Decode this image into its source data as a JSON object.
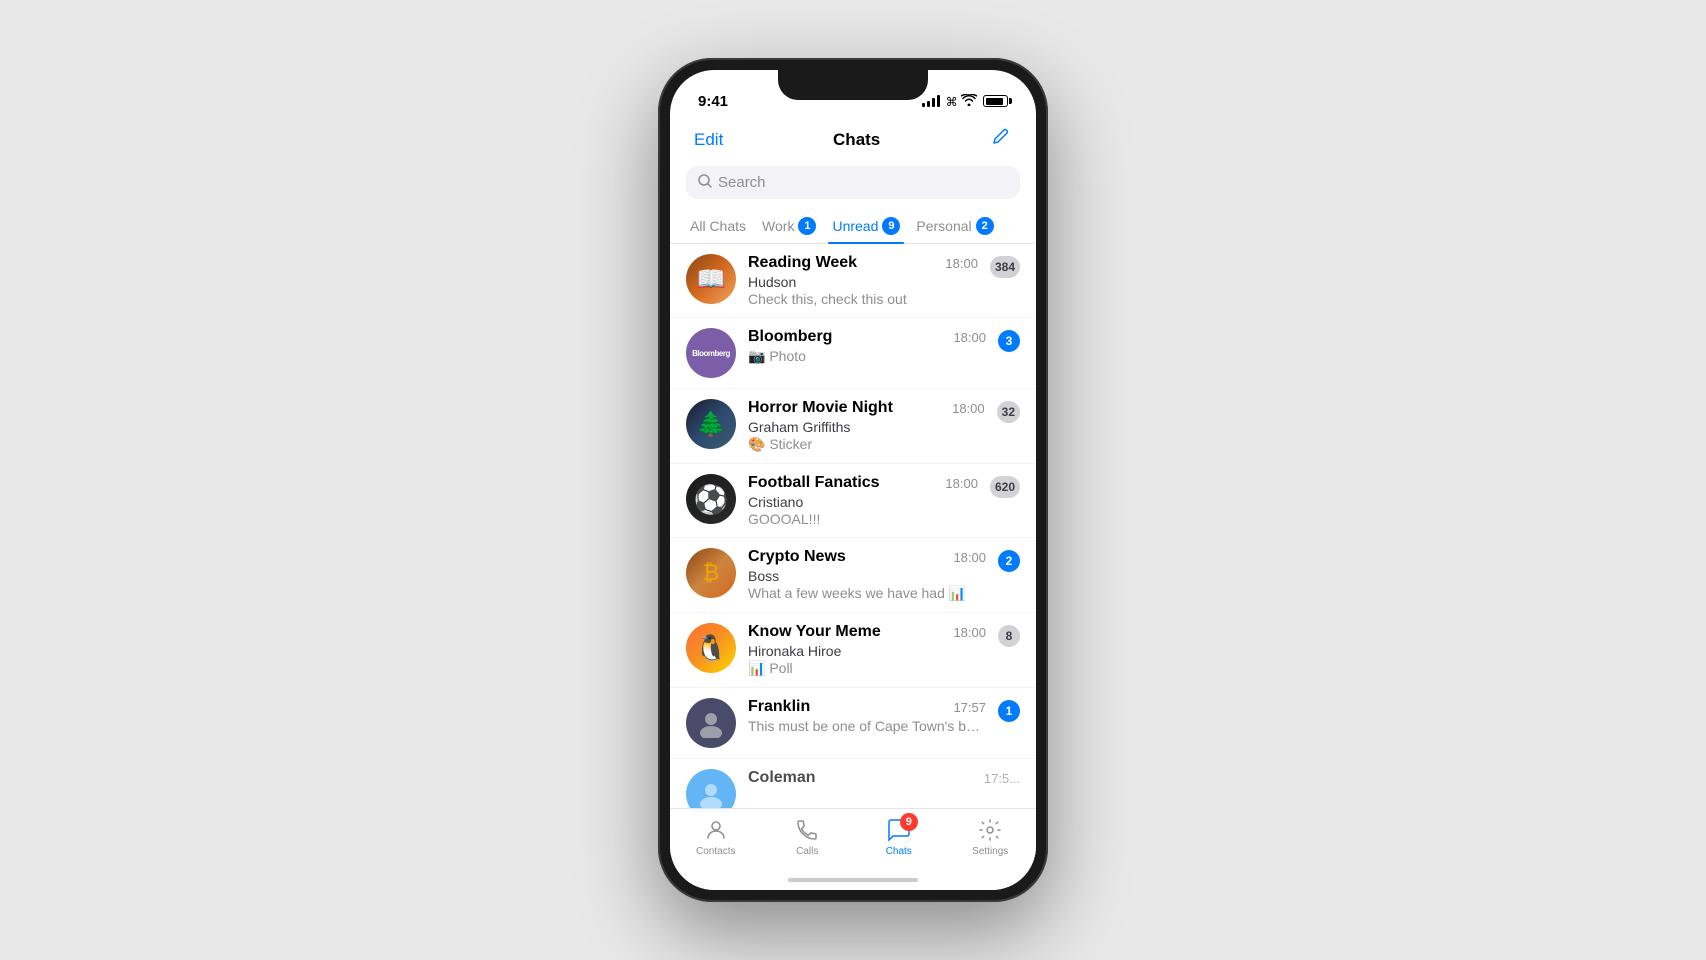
{
  "phone": {
    "status_bar": {
      "time": "9:41",
      "battery_level": 85
    },
    "header": {
      "edit_label": "Edit",
      "title": "Chats",
      "compose_icon": "✏"
    },
    "search": {
      "placeholder": "Search"
    },
    "tabs": [
      {
        "id": "all",
        "label": "All Chats",
        "badge": null,
        "badge_type": null,
        "active": false
      },
      {
        "id": "work",
        "label": "Work",
        "badge": "1",
        "badge_type": "blue",
        "active": false
      },
      {
        "id": "unread",
        "label": "Unread",
        "badge": "9",
        "badge_type": "blue",
        "active": true
      },
      {
        "id": "personal",
        "label": "Personal",
        "badge": "2",
        "badge_type": "blue",
        "active": false
      }
    ],
    "chats": [
      {
        "id": 1,
        "name": "Reading Week",
        "sender": "Hudson",
        "preview": "Check this, check this out",
        "time": "18:00",
        "unread": "384",
        "unread_type": "gray",
        "avatar_type": "reading-week",
        "avatar_emoji": "📚"
      },
      {
        "id": 2,
        "name": "Bloomberg",
        "sender": "",
        "preview": "📷 Photo",
        "time": "18:00",
        "unread": "3",
        "unread_type": "blue",
        "avatar_type": "bloomberg",
        "avatar_emoji": "Bloomberg"
      },
      {
        "id": 3,
        "name": "Horror Movie Night",
        "sender": "Graham Griffiths",
        "preview": "🎨 Sticker",
        "time": "18:00",
        "unread": "32",
        "unread_type": "gray",
        "avatar_type": "horror",
        "avatar_emoji": "🌲"
      },
      {
        "id": 4,
        "name": "Football Fanatics",
        "sender": "Cristiano",
        "preview": "GOOOAL!!!",
        "time": "18:00",
        "unread": "620",
        "unread_type": "gray",
        "avatar_type": "football",
        "avatar_emoji": "⚽"
      },
      {
        "id": 5,
        "name": "Crypto News",
        "sender": "Boss",
        "preview": "What a few weeks we have had 📊",
        "time": "18:00",
        "unread": "2",
        "unread_type": "blue",
        "avatar_type": "crypto",
        "avatar_emoji": "₿"
      },
      {
        "id": 6,
        "name": "Know Your Meme",
        "sender": "Hironaka Hiroe",
        "preview": "📊 Poll",
        "time": "18:00",
        "unread": "8",
        "unread_type": "gray",
        "avatar_type": "meme",
        "avatar_emoji": "🐧"
      },
      {
        "id": 7,
        "name": "Franklin",
        "sender": "",
        "preview": "This must be one of Cape Town's best spots for a stunning view of...",
        "time": "17:57",
        "unread": "1",
        "unread_type": "blue",
        "avatar_type": "franklin",
        "avatar_emoji": "👤"
      },
      {
        "id": 8,
        "name": "Coleman",
        "sender": "",
        "preview": "",
        "time": "17:5...",
        "unread": null,
        "unread_type": null,
        "avatar_type": "coleman",
        "avatar_emoji": "👤"
      }
    ],
    "tab_bar": {
      "items": [
        {
          "id": "contacts",
          "label": "Contacts",
          "icon": "person",
          "active": false,
          "badge": null
        },
        {
          "id": "calls",
          "label": "Calls",
          "icon": "phone",
          "active": false,
          "badge": null
        },
        {
          "id": "chats",
          "label": "Chats",
          "icon": "bubble",
          "active": true,
          "badge": "9"
        },
        {
          "id": "settings",
          "label": "Settings",
          "icon": "gear",
          "active": false,
          "badge": null
        }
      ]
    }
  }
}
